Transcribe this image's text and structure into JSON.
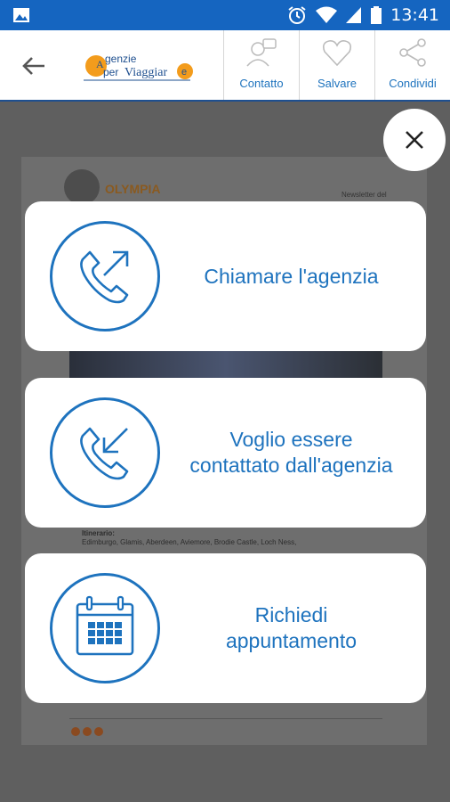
{
  "status_bar": {
    "time": "13:41",
    "left_icon": "image-icon",
    "icons": [
      "alarm-icon",
      "wifi-icon",
      "signal-icon",
      "battery-icon"
    ]
  },
  "app_bar": {
    "back_icon": "arrow-back-icon",
    "logo_text": "AgenzieperViaggiare",
    "actions": [
      {
        "label": "Contatto",
        "icon": "contact-icon"
      },
      {
        "label": "Salvare",
        "icon": "heart-icon"
      },
      {
        "label": "Condividi",
        "icon": "share-icon"
      }
    ]
  },
  "background_page": {
    "brand": "OLYMPIA",
    "newsletter": "Newsletter del",
    "itinerary_title": "Itinerario:",
    "itinerary_text": "Edimburgo, Glamis, Aberdeen, Aviemore, Brodie Castle, Loch Ness,"
  },
  "modal": {
    "close_icon": "close-icon",
    "options": [
      {
        "label": "Chiamare l'agenzia",
        "icon": "phone-outgoing-icon"
      },
      {
        "label": "Voglio essere\ncontattato dall'agenzia",
        "icon": "phone-incoming-icon"
      },
      {
        "label": "Richiedi\nappuntamento",
        "icon": "calendar-icon"
      }
    ]
  },
  "colors": {
    "status_bar": "#1565c0",
    "accent": "#1e73be",
    "overlay": "#5f5f5f"
  }
}
